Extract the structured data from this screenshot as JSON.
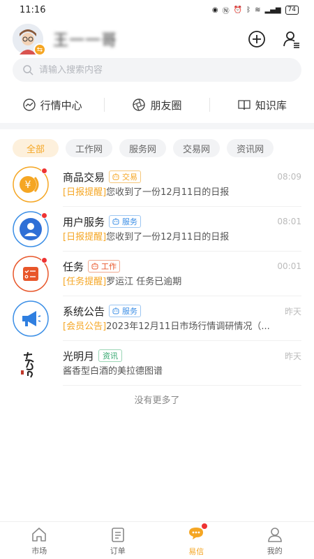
{
  "status_bar": {
    "time": "11:16",
    "battery": "74"
  },
  "header": {
    "user_name": "王一一哥"
  },
  "search": {
    "placeholder": "请输入搜索内容"
  },
  "quick_nav": [
    {
      "label": "行情中心",
      "icon": "trend-icon"
    },
    {
      "label": "朋友圈",
      "icon": "aperture-icon"
    },
    {
      "label": "知识库",
      "icon": "book-icon"
    }
  ],
  "filters": [
    "全部",
    "工作网",
    "服务网",
    "交易网",
    "资讯网"
  ],
  "messages": [
    {
      "title": "商品交易",
      "tag": "交易",
      "time": "08:09",
      "prefix": "[日报提醒]",
      "text": "您收到了一份12月11日的日报"
    },
    {
      "title": "用户服务",
      "tag": "服务",
      "time": "08:01",
      "prefix": "[日报提醒]",
      "text": "您收到了一份12月11日的日报"
    },
    {
      "title": "任务",
      "tag": "工作",
      "time": "00:01",
      "prefix": "[任务提醒]",
      "text": "罗运江 任务已逾期"
    },
    {
      "title": "系统公告",
      "tag": "服务",
      "time": "昨天",
      "prefix": "[会员公告]",
      "text": "2023年12月11日市场行情调研情况（..."
    },
    {
      "title": "光明月",
      "tag": "资讯",
      "time": "昨天",
      "prefix": "",
      "text": "酱香型白酒的美拉德图谱"
    }
  ],
  "list_footer": "没有更多了",
  "tabbar": [
    {
      "label": "市场"
    },
    {
      "label": "订单"
    },
    {
      "label": "易信"
    },
    {
      "label": "我的"
    }
  ],
  "colors": {
    "accent": "#f5a623",
    "blue": "#3a8ee6",
    "red": "#e33333",
    "green": "#2fa56b"
  }
}
